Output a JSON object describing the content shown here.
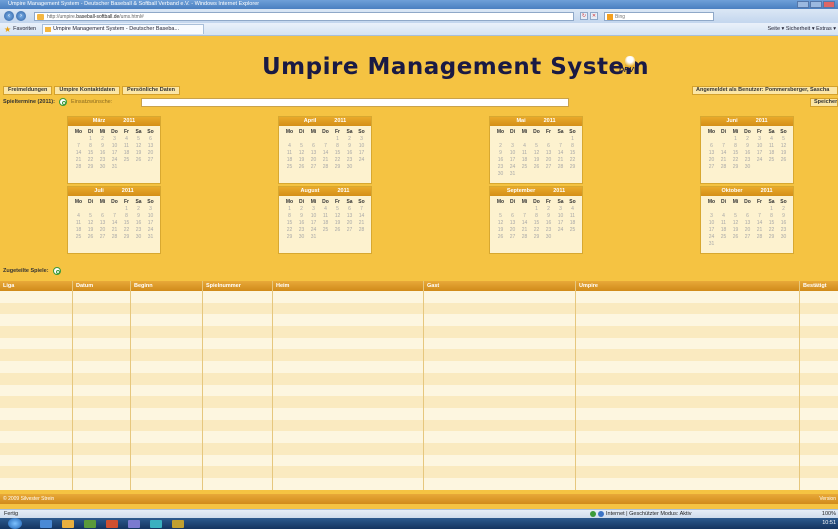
{
  "browser": {
    "window_title": "Umpire Management System - Deutscher Baseball & Softball Verband e.V. - Windows Internet Explorer",
    "url_prefix": "http://umpire.",
    "url_domain": "baseball-softball.de",
    "url_path": "/ums.html#",
    "search_placeholder": "Bing",
    "favorites_label": "Favoriten",
    "tab_title": "Umpire Management System - Deutscher Baseba...",
    "command_bar": "Seite ▾  Sicherheit ▾  Extras ▾",
    "status_text": "Fertig",
    "zone_text": "Internet | Geschützter Modus: Aktiv",
    "zoom_text": "100%",
    "clock": "10:51"
  },
  "app": {
    "title": "Umpire Management System",
    "logo_text": "DRV",
    "tabs": [
      "Freimeldungen",
      "Umpire Kontaktdaten",
      "Persönliche Daten"
    ],
    "login_info": "Angemeldet als Benutzer: Pommersberger, Sascha",
    "filter_label": "Spieltermine (2011):",
    "wishes_label": "Einsatzwünsche:",
    "wishes_value": "",
    "save_label": "Speichern",
    "assigned_label": "Zugeteilte Spiele:",
    "footer_left": "© 2009 Silvester Strein",
    "footer_right": "Version"
  },
  "weekday_headers": [
    "Mo",
    "Di",
    "Mi",
    "Do",
    "Fr",
    "Sa",
    "So"
  ],
  "calendars": [
    {
      "month": "März",
      "year": "2011",
      "offset": 1,
      "days": 31
    },
    {
      "month": "April",
      "year": "2011",
      "offset": 4,
      "days": 30
    },
    {
      "month": "Mai",
      "year": "2011",
      "offset": 6,
      "days": 31
    },
    {
      "month": "Juni",
      "year": "2011",
      "offset": 2,
      "days": 30
    },
    {
      "month": "Juli",
      "year": "2011",
      "offset": 4,
      "days": 31
    },
    {
      "month": "August",
      "year": "2011",
      "offset": 0,
      "days": 31
    },
    {
      "month": "September",
      "year": "2011",
      "offset": 3,
      "days": 30
    },
    {
      "month": "Oktober",
      "year": "2011",
      "offset": 5,
      "days": 31
    }
  ],
  "table": {
    "columns": [
      "Liga",
      "Datum",
      "Beginn",
      "Spielnummer",
      "Heim",
      "Gast",
      "Umpire",
      "Bestätigt"
    ],
    "row_count": 17
  }
}
